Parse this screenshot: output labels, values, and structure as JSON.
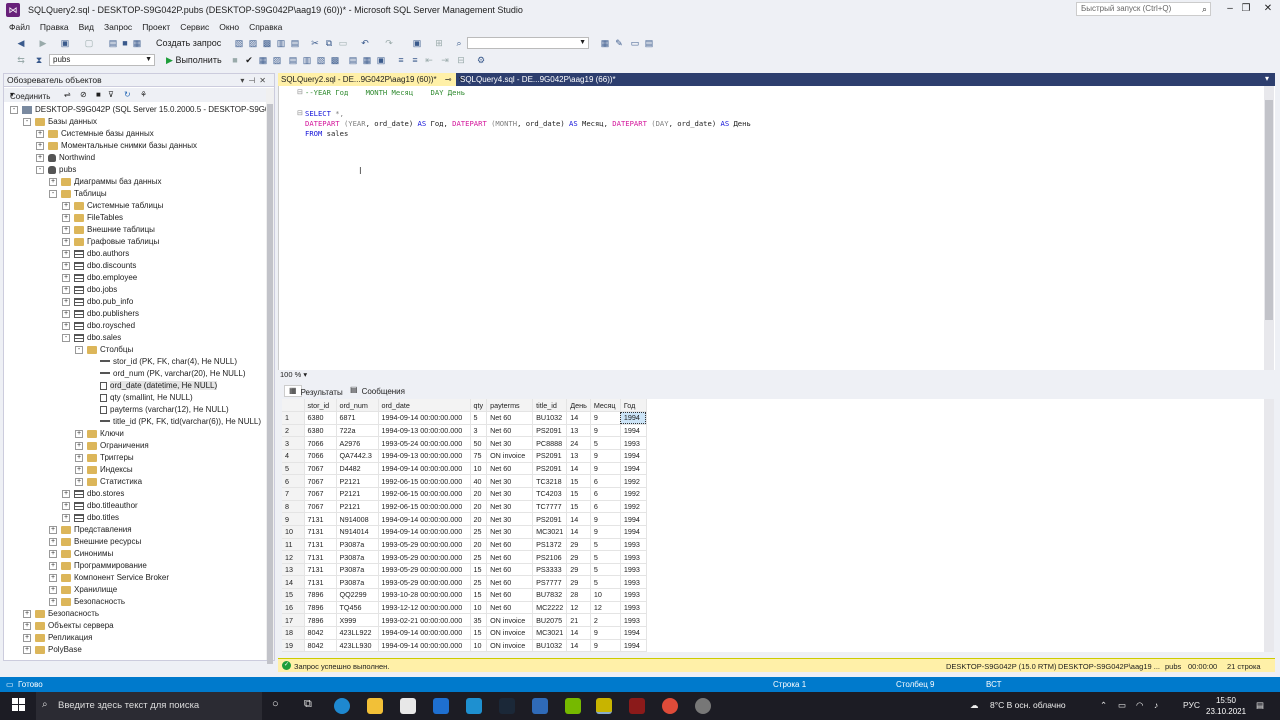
{
  "window": {
    "title": "SQLQuery2.sql - DESKTOP-S9G042P.pubs (DESKTOP-S9G042P\\aag19 (60))* - Microsoft SQL Server Management Studio",
    "quick_launch_placeholder": "Быстрый запуск (Ctrl+Q)"
  },
  "menu": [
    "Файл",
    "Правка",
    "Вид",
    "Запрос",
    "Проект",
    "Сервис",
    "Окно",
    "Справка"
  ],
  "toolbar": {
    "new_query": "Создать запрос",
    "database": "pubs",
    "execute": "Выполнить"
  },
  "object_explorer": {
    "title": "Обозреватель объектов",
    "connect": "Соединить",
    "tree": [
      {
        "label": "DESKTOP-S9G042P (SQL Server 15.0.2000.5 - DESKTOP-S9G042P\\aag19)",
        "icon": "server",
        "exp": "-",
        "level": 0
      },
      {
        "label": "Базы данных",
        "icon": "folder",
        "exp": "-",
        "level": 1
      },
      {
        "label": "Системные базы данных",
        "icon": "folder",
        "exp": "+",
        "level": 2
      },
      {
        "label": "Моментальные снимки базы данных",
        "icon": "folder",
        "exp": "+",
        "level": 2
      },
      {
        "label": "Northwind",
        "icon": "db",
        "exp": "+",
        "level": 2
      },
      {
        "label": "pubs",
        "icon": "db",
        "exp": "-",
        "level": 2
      },
      {
        "label": "Диаграммы баз данных",
        "icon": "folder",
        "exp": "+",
        "level": 3
      },
      {
        "label": "Таблицы",
        "icon": "folder",
        "exp": "-",
        "level": 3
      },
      {
        "label": "Системные таблицы",
        "icon": "folder",
        "exp": "+",
        "level": 4
      },
      {
        "label": "FileTables",
        "icon": "folder",
        "exp": "+",
        "level": 4
      },
      {
        "label": "Внешние таблицы",
        "icon": "folder",
        "exp": "+",
        "level": 4
      },
      {
        "label": "Графовые таблицы",
        "icon": "folder",
        "exp": "+",
        "level": 4
      },
      {
        "label": "dbo.authors",
        "icon": "table",
        "exp": "+",
        "level": 4
      },
      {
        "label": "dbo.discounts",
        "icon": "table",
        "exp": "+",
        "level": 4
      },
      {
        "label": "dbo.employee",
        "icon": "table",
        "exp": "+",
        "level": 4
      },
      {
        "label": "dbo.jobs",
        "icon": "table",
        "exp": "+",
        "level": 4
      },
      {
        "label": "dbo.pub_info",
        "icon": "table",
        "exp": "+",
        "level": 4
      },
      {
        "label": "dbo.publishers",
        "icon": "table",
        "exp": "+",
        "level": 4
      },
      {
        "label": "dbo.roysched",
        "icon": "table",
        "exp": "+",
        "level": 4
      },
      {
        "label": "dbo.sales",
        "icon": "table",
        "exp": "-",
        "level": 4
      },
      {
        "label": "Столбцы",
        "icon": "folder",
        "exp": "-",
        "level": 5
      },
      {
        "label": "stor_id (PK, FK, char(4), Не NULL)",
        "icon": "key",
        "exp": "",
        "level": 6
      },
      {
        "label": "ord_num (PK, varchar(20), Не NULL)",
        "icon": "key",
        "exp": "",
        "level": 6
      },
      {
        "label": "ord_date (datetime, Не NULL)",
        "icon": "col",
        "exp": "",
        "level": 6
      },
      {
        "label": "qty (smallint, Не NULL)",
        "icon": "col",
        "exp": "",
        "level": 6
      },
      {
        "label": "payterms (varchar(12), Не NULL)",
        "icon": "col",
        "exp": "",
        "level": 6
      },
      {
        "label": "title_id (PK, FK, tid(varchar(6)), Не NULL)",
        "icon": "key",
        "exp": "",
        "level": 6
      },
      {
        "label": "Ключи",
        "icon": "folder",
        "exp": "+",
        "level": 5
      },
      {
        "label": "Ограничения",
        "icon": "folder",
        "exp": "+",
        "level": 5
      },
      {
        "label": "Триггеры",
        "icon": "folder",
        "exp": "+",
        "level": 5
      },
      {
        "label": "Индексы",
        "icon": "folder",
        "exp": "+",
        "level": 5
      },
      {
        "label": "Статистика",
        "icon": "folder",
        "exp": "+",
        "level": 5
      },
      {
        "label": "dbo.stores",
        "icon": "table",
        "exp": "+",
        "level": 4
      },
      {
        "label": "dbo.titleauthor",
        "icon": "table",
        "exp": "+",
        "level": 4
      },
      {
        "label": "dbo.titles",
        "icon": "table",
        "exp": "+",
        "level": 4
      },
      {
        "label": "Представления",
        "icon": "folder",
        "exp": "+",
        "level": 3
      },
      {
        "label": "Внешние ресурсы",
        "icon": "folder",
        "exp": "+",
        "level": 3
      },
      {
        "label": "Синонимы",
        "icon": "folder",
        "exp": "+",
        "level": 3
      },
      {
        "label": "Программирование",
        "icon": "folder",
        "exp": "+",
        "level": 3
      },
      {
        "label": "Компонент Service Broker",
        "icon": "folder",
        "exp": "+",
        "level": 3
      },
      {
        "label": "Хранилище",
        "icon": "folder",
        "exp": "+",
        "level": 3
      },
      {
        "label": "Безопасность",
        "icon": "folder",
        "exp": "+",
        "level": 3
      },
      {
        "label": "Безопасность",
        "icon": "folder",
        "exp": "+",
        "level": 1
      },
      {
        "label": "Объекты сервера",
        "icon": "folder",
        "exp": "+",
        "level": 1
      },
      {
        "label": "Репликация",
        "icon": "folder",
        "exp": "+",
        "level": 1
      },
      {
        "label": "PolyBase",
        "icon": "folder",
        "exp": "+",
        "level": 1
      }
    ]
  },
  "tabs": {
    "active": "SQLQuery2.sql - DE...9G042P\\aag19 (60))*",
    "inactive": "SQLQuery4.sql - DE...9G042P\\aag19 (66))*"
  },
  "editor": {
    "line1": "--YEAR Год    MONTH Месяц    DAY День",
    "select": "SELECT",
    "star": " *,",
    "l3_a": "DATEPART",
    "l3_b": " (YEAR",
    "l3_c": ", ord_date) ",
    "l3_d": "AS",
    "l3_e": " Год, ",
    "l3_f": "DATEPART",
    "l3_g": " (MONTH",
    "l3_h": ", ord_date) ",
    "l3_i": "AS",
    "l3_j": " Месяц, ",
    "l3_k": "DATEPART",
    "l3_l": " (DAY",
    "l3_m": ", ord_date) ",
    "l3_n": "AS",
    "l3_o": " День",
    "from": "FROM",
    "table": " sales",
    "zoom": "100 %"
  },
  "results": {
    "tab_results": "Результаты",
    "tab_messages": "Сообщения",
    "columns": [
      "stor_id",
      "ord_num",
      "ord_date",
      "qty",
      "payterms",
      "title_id",
      "День",
      "Месяц",
      "Год"
    ],
    "rows": [
      [
        "1",
        "6380",
        "6871",
        "1994-09-14 00:00:00.000",
        "5",
        "Net 60",
        "BU1032",
        "14",
        "9",
        "1994"
      ],
      [
        "2",
        "6380",
        "722a",
        "1994-09-13 00:00:00.000",
        "3",
        "Net 60",
        "PS2091",
        "13",
        "9",
        "1994"
      ],
      [
        "3",
        "7066",
        "A2976",
        "1993-05-24 00:00:00.000",
        "50",
        "Net 30",
        "PC8888",
        "24",
        "5",
        "1993"
      ],
      [
        "4",
        "7066",
        "QA7442.3",
        "1994-09-13 00:00:00.000",
        "75",
        "ON invoice",
        "PS2091",
        "13",
        "9",
        "1994"
      ],
      [
        "5",
        "7067",
        "D4482",
        "1994-09-14 00:00:00.000",
        "10",
        "Net 60",
        "PS2091",
        "14",
        "9",
        "1994"
      ],
      [
        "6",
        "7067",
        "P2121",
        "1992-06-15 00:00:00.000",
        "40",
        "Net 30",
        "TC3218",
        "15",
        "6",
        "1992"
      ],
      [
        "7",
        "7067",
        "P2121",
        "1992-06-15 00:00:00.000",
        "20",
        "Net 30",
        "TC4203",
        "15",
        "6",
        "1992"
      ],
      [
        "8",
        "7067",
        "P2121",
        "1992-06-15 00:00:00.000",
        "20",
        "Net 30",
        "TC7777",
        "15",
        "6",
        "1992"
      ],
      [
        "9",
        "7131",
        "N914008",
        "1994-09-14 00:00:00.000",
        "20",
        "Net 30",
        "PS2091",
        "14",
        "9",
        "1994"
      ],
      [
        "10",
        "7131",
        "N914014",
        "1994-09-14 00:00:00.000",
        "25",
        "Net 30",
        "MC3021",
        "14",
        "9",
        "1994"
      ],
      [
        "11",
        "7131",
        "P3087a",
        "1993-05-29 00:00:00.000",
        "20",
        "Net 60",
        "PS1372",
        "29",
        "5",
        "1993"
      ],
      [
        "12",
        "7131",
        "P3087a",
        "1993-05-29 00:00:00.000",
        "25",
        "Net 60",
        "PS2106",
        "29",
        "5",
        "1993"
      ],
      [
        "13",
        "7131",
        "P3087a",
        "1993-05-29 00:00:00.000",
        "15",
        "Net 60",
        "PS3333",
        "29",
        "5",
        "1993"
      ],
      [
        "14",
        "7131",
        "P3087a",
        "1993-05-29 00:00:00.000",
        "25",
        "Net 60",
        "PS7777",
        "29",
        "5",
        "1993"
      ],
      [
        "15",
        "7896",
        "QQ2299",
        "1993-10-28 00:00:00.000",
        "15",
        "Net 60",
        "BU7832",
        "28",
        "10",
        "1993"
      ],
      [
        "16",
        "7896",
        "TQ456",
        "1993-12-12 00:00:00.000",
        "10",
        "Net 60",
        "MC2222",
        "12",
        "12",
        "1993"
      ],
      [
        "17",
        "7896",
        "X999",
        "1993-02-21 00:00:00.000",
        "35",
        "ON invoice",
        "BU2075",
        "21",
        "2",
        "1993"
      ],
      [
        "18",
        "8042",
        "423LL922",
        "1994-09-14 00:00:00.000",
        "15",
        "ON invoice",
        "MC3021",
        "14",
        "9",
        "1994"
      ],
      [
        "19",
        "8042",
        "423LL930",
        "1994-09-14 00:00:00.000",
        "10",
        "ON invoice",
        "BU1032",
        "14",
        "9",
        "1994"
      ]
    ]
  },
  "query_status": {
    "message": "Запрос успешно выполнен.",
    "server": "DESKTOP-S9G042P (15.0 RTM)",
    "user": "DESKTOP-S9G042P\\aag19 ...",
    "db": "pubs",
    "time": "00:00:00",
    "rows": "21 строка"
  },
  "app_status": {
    "ready": "Готово",
    "row": "Строка 1",
    "col": "Столбец 9",
    "mode": "ВСТ"
  },
  "taskbar": {
    "search_placeholder": "Введите здесь текст для поиска",
    "weather": "8°C  В осн. облачно",
    "lang": "РУС",
    "time": "15:50",
    "date": "23.10.2021"
  },
  "colors": {
    "accent": "#007acc",
    "tab_active": "#fff0a8",
    "taskbar": "#1c1c24"
  }
}
